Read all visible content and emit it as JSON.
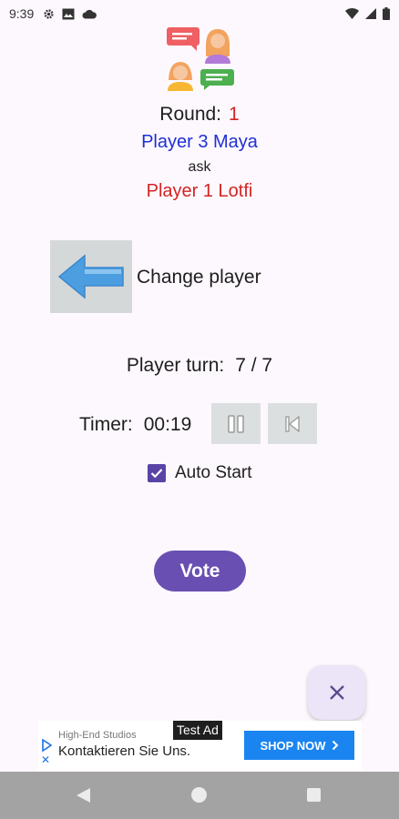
{
  "status_bar": {
    "time": "9:39",
    "icons_left": [
      "gear-icon",
      "image-icon",
      "cloud-icon"
    ],
    "icons_right": [
      "wifi-icon",
      "signal-icon",
      "battery-icon"
    ]
  },
  "header": {
    "illustration": "chat-people-icon"
  },
  "round": {
    "label": "Round:",
    "value": "1"
  },
  "asker": "Player 3 Maya",
  "ask_label": "ask",
  "target": "Player 1 Lotfi",
  "change_player": {
    "label": "Change player",
    "icon": "arrow-left-icon"
  },
  "player_turn": {
    "label": "Player turn:",
    "value": "7 / 7"
  },
  "timer": {
    "label": "Timer:",
    "value": "00:19"
  },
  "auto_start": {
    "label": "Auto Start",
    "checked": true
  },
  "vote_button": "Vote",
  "fab_icon": "close-icon",
  "ad": {
    "tag": "Test Ad",
    "advertiser": "High-End Studios",
    "headline": "Kontaktieren Sie Uns.",
    "cta": "SHOP NOW"
  },
  "colors": {
    "accent": "#6a4fb2",
    "red": "#d32424",
    "blue": "#1e2fd6",
    "background": "#fdf8fd",
    "ad_cta": "#1a84f0"
  }
}
